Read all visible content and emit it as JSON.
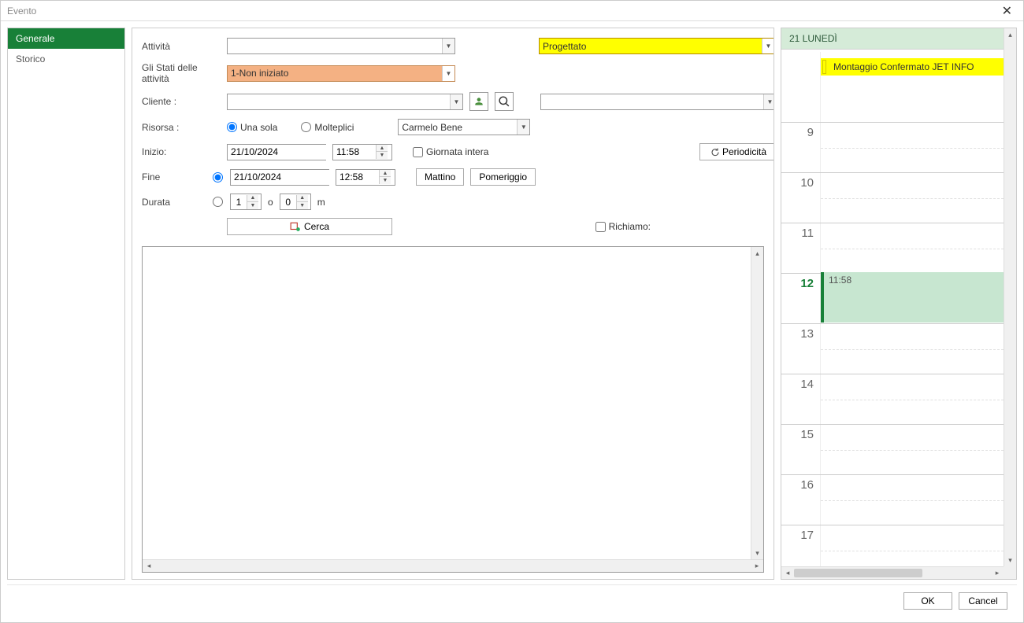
{
  "window": {
    "title": "Evento"
  },
  "tabs": {
    "general": "Generale",
    "history": "Storico"
  },
  "labels": {
    "activity": "Attività",
    "activity_states": "Gli Stati delle attività",
    "client": "Cliente :",
    "resource": "Risorsa :",
    "start": "Inizio:",
    "end": "Fine",
    "duration": "Durata",
    "ore_sep": "o",
    "min_suffix": "m"
  },
  "fields": {
    "activity": "",
    "status": "Progettato",
    "activity_state": "1-Non iniziato",
    "client": "",
    "client2": "",
    "resource_mode_single": "Una sola",
    "resource_mode_multi": "Molteplici",
    "resource": "Carmelo Bene",
    "start_date": "21/10/2024",
    "start_time": "11:58",
    "end_date": "21/10/2024",
    "end_time": "12:58",
    "allday_label": "Giornata intera",
    "duration_h": "1",
    "duration_m": "0",
    "search_label": "Cerca",
    "recurrence_label": "Periodicità",
    "morning_label": "Mattino",
    "afternoon_label": "Pomeriggio",
    "reminder_label": "Richiamo:"
  },
  "calendar": {
    "header": "21 LUNEDÌ",
    "allday_event": "Montaggio Confermato JET INFO",
    "hours": [
      "9",
      "10",
      "11",
      "12",
      "13",
      "14",
      "15",
      "16",
      "17"
    ],
    "current_hour_index": 3,
    "selection_label": "11:58"
  },
  "footer": {
    "ok": "OK",
    "cancel": "Cancel"
  }
}
